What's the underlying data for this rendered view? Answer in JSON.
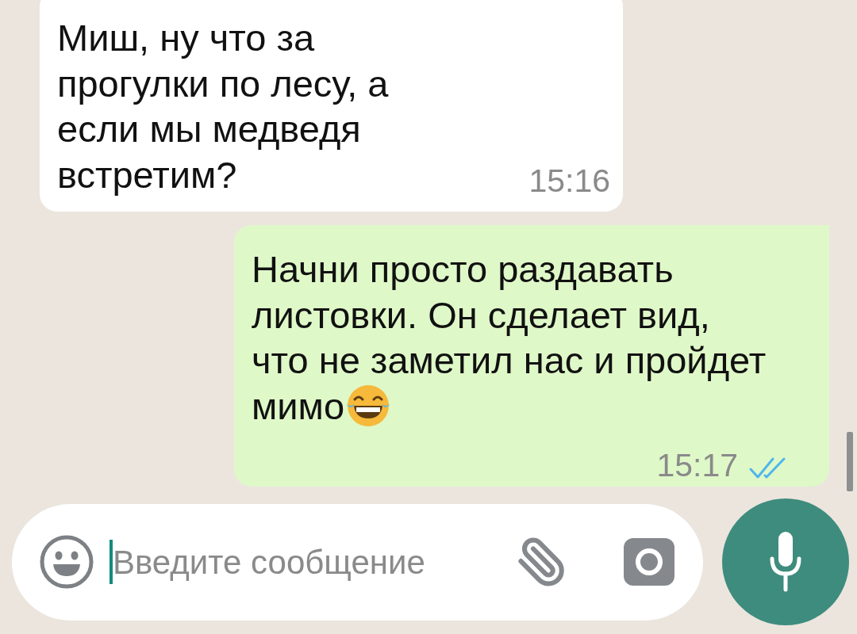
{
  "messages": [
    {
      "kind": "incoming",
      "lines": [
        "Миш, ну что за",
        "прогулки по лесу, а",
        "если мы медведя",
        "встретим?"
      ],
      "time": "15:16"
    },
    {
      "kind": "outgoing",
      "lines": [
        "Начни просто раздавать",
        "листовки. Он сделает вид,",
        "что не заметил нас и пройдет",
        "мимо"
      ],
      "emoji_at_end": true,
      "time": "15:17",
      "read": true
    }
  ],
  "composer": {
    "placeholder": "Введите сообщение",
    "focused": true
  }
}
